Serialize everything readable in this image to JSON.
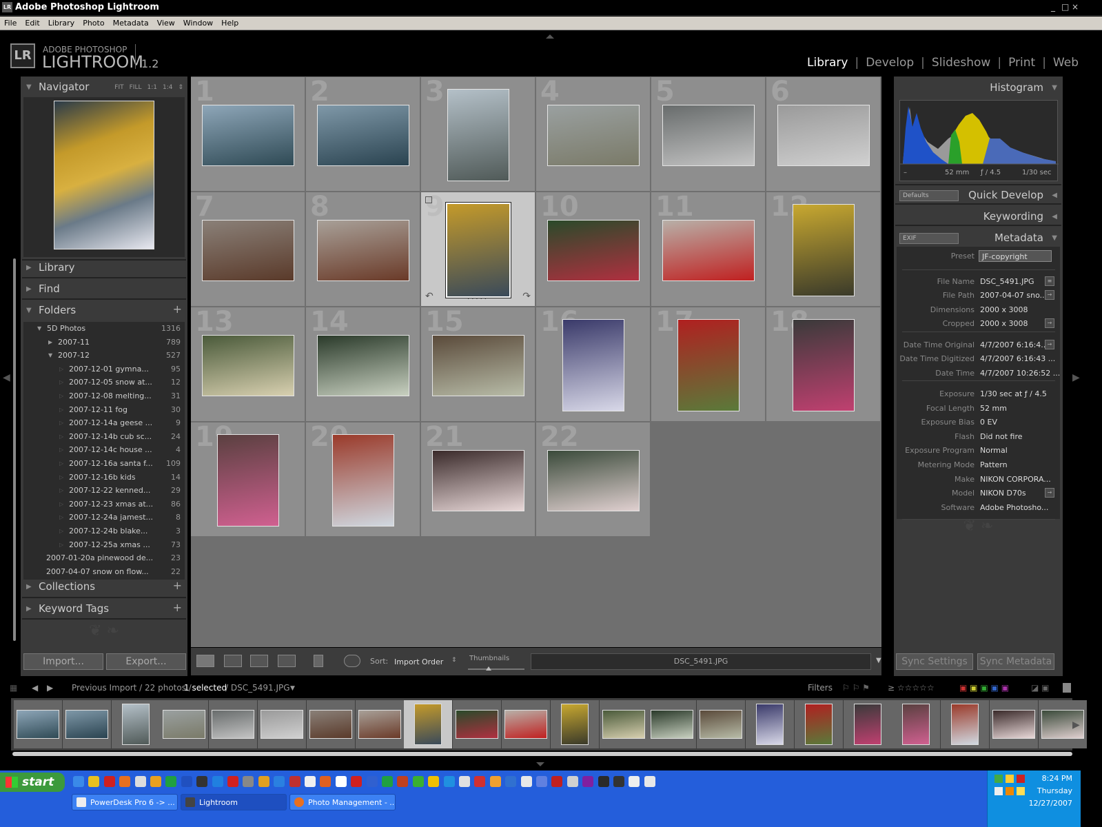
{
  "window": {
    "title": "Adobe Photoshop Lightroom",
    "controls": [
      "_",
      "□",
      "×"
    ]
  },
  "menu": [
    "File",
    "Edit",
    "Library",
    "Photo",
    "Metadata",
    "View",
    "Window",
    "Help"
  ],
  "logo": {
    "box": "LR",
    "line1": "ADOBE PHOTOSHOP",
    "line2": "LIGHTROOM",
    "version": "1.2"
  },
  "modules": [
    "Library",
    "Develop",
    "Slideshow",
    "Print",
    "Web"
  ],
  "navigator": {
    "label": "Navigator",
    "zoom": [
      "FIT",
      "FILL",
      "1:1",
      "1:4"
    ]
  },
  "left_panels": {
    "library": "Library",
    "find": "Find",
    "folders": "Folders",
    "collections": "Collections",
    "keyword_tags": "Keyword Tags"
  },
  "folders": [
    {
      "name": "5D Photos",
      "count": "1316",
      "level": 0,
      "expanded": true
    },
    {
      "name": "2007-11",
      "count": "789",
      "level": 1,
      "expanded": false
    },
    {
      "name": "2007-12",
      "count": "527",
      "level": 1,
      "expanded": true
    },
    {
      "name": "2007-12-01 gymna...",
      "count": "95",
      "level": 2
    },
    {
      "name": "2007-12-05 snow at...",
      "count": "12",
      "level": 2
    },
    {
      "name": "2007-12-08 melting...",
      "count": "31",
      "level": 2
    },
    {
      "name": "2007-12-11 fog",
      "count": "30",
      "level": 2
    },
    {
      "name": "2007-12-14a geese ...",
      "count": "9",
      "level": 2
    },
    {
      "name": "2007-12-14b cub sc...",
      "count": "24",
      "level": 2
    },
    {
      "name": "2007-12-14c house ...",
      "count": "4",
      "level": 2
    },
    {
      "name": "2007-12-16a santa f...",
      "count": "109",
      "level": 2
    },
    {
      "name": "2007-12-16b kids",
      "count": "14",
      "level": 2
    },
    {
      "name": "2007-12-22 kenned...",
      "count": "29",
      "level": 2
    },
    {
      "name": "2007-12-23 xmas at...",
      "count": "86",
      "level": 2
    },
    {
      "name": "2007-12-24a jamest...",
      "count": "8",
      "level": 2
    },
    {
      "name": "2007-12-24b blake...",
      "count": "3",
      "level": 2
    },
    {
      "name": "2007-12-25a xmas ...",
      "count": "73",
      "level": 2
    },
    {
      "name": "2007-01-20a pinewood de...",
      "count": "23",
      "level": -1
    },
    {
      "name": "2007-04-07 snow on flow...",
      "count": "22",
      "level": -1
    }
  ],
  "buttons": {
    "import": "Import...",
    "export": "Export...",
    "sync_settings": "Sync Settings",
    "sync_metadata": "Sync Metadata"
  },
  "grid": [
    {
      "n": "1",
      "o": "l",
      "c1": "#8ea6b8",
      "c2": "#2f4a55"
    },
    {
      "n": "2",
      "o": "l",
      "c1": "#7f98a8",
      "c2": "#2a4350"
    },
    {
      "n": "3",
      "o": "p",
      "c1": "#b4c0c8",
      "c2": "#505a58"
    },
    {
      "n": "4",
      "o": "l",
      "c1": "#9aa0a0",
      "c2": "#7a7a68"
    },
    {
      "n": "5",
      "o": "l",
      "c1": "#686c6c",
      "c2": "#c4c4c4"
    },
    {
      "n": "6",
      "o": "l",
      "c1": "#9a9a9a",
      "c2": "#d0d0d0"
    },
    {
      "n": "7",
      "o": "l",
      "c1": "#8a8078",
      "c2": "#5a3a2a"
    },
    {
      "n": "8",
      "o": "l",
      "c1": "#a8a098",
      "c2": "#6a3a28"
    },
    {
      "n": "9",
      "o": "p",
      "c1": "#c49a2a",
      "c2": "#3a4a5a",
      "selected": true
    },
    {
      "n": "10",
      "o": "l",
      "c1": "#2a4a2a",
      "c2": "#b03040"
    },
    {
      "n": "11",
      "o": "l",
      "c1": "#b8b0a8",
      "c2": "#c02020"
    },
    {
      "n": "12",
      "o": "p",
      "c1": "#c8a830",
      "c2": "#3a3a2a"
    },
    {
      "n": "13",
      "o": "l",
      "c1": "#4a5a3a",
      "c2": "#d8d0b0"
    },
    {
      "n": "14",
      "o": "l",
      "c1": "#2a3a2a",
      "c2": "#c8d0c0"
    },
    {
      "n": "15",
      "o": "l",
      "c1": "#5a4a3a",
      "c2": "#b8bca8"
    },
    {
      "n": "16",
      "o": "p",
      "c1": "#3a3a6a",
      "c2": "#d8d8e8"
    },
    {
      "n": "17",
      "o": "p",
      "c1": "#b02020",
      "c2": "#5a7a3a"
    },
    {
      "n": "18",
      "o": "p",
      "c1": "#3a3a3a",
      "c2": "#c04070"
    },
    {
      "n": "19",
      "o": "p",
      "c1": "#5a4040",
      "c2": "#d06090"
    },
    {
      "n": "20",
      "o": "p",
      "c1": "#9a3a2a",
      "c2": "#d0d8e0"
    },
    {
      "n": "21",
      "o": "l",
      "c1": "#3a2a2a",
      "c2": "#e8d8d8"
    },
    {
      "n": "22",
      "o": "l",
      "c1": "#3a4a3a",
      "c2": "#e0d0d0"
    }
  ],
  "toolbar": {
    "sort_label": "Sort:",
    "sort_value": "Import Order",
    "thumbnails_label": "Thumbnails",
    "filename": "DSC_5491.JPG"
  },
  "histogram": {
    "label": "Histogram",
    "focal": "52 mm",
    "aperture": "ƒ / 4.5",
    "shutter": "1/30 sec",
    "dash": "–"
  },
  "quick_develop": {
    "label": "Quick Develop",
    "preset": "Defaults"
  },
  "keywording": {
    "label": "Keywording"
  },
  "metadata": {
    "label": "Metadata",
    "set": "EXIF",
    "preset_label": "Preset",
    "preset_value": "JF-copyright",
    "rows": [
      {
        "k": "File Name",
        "v": "DSC_5491.JPG",
        "btn": "≡"
      },
      {
        "k": "File Path",
        "v": "2007-04-07 sno...",
        "btn": "→"
      },
      {
        "k": "Dimensions",
        "v": "2000 x 3008"
      },
      {
        "k": "Cropped",
        "v": "2000 x 3008",
        "btn": "→"
      },
      {
        "k": "Date Time Original",
        "v": "4/7/2007 6:16:4...",
        "btn": "→"
      },
      {
        "k": "Date Time Digitized",
        "v": "4/7/2007 6:16:43 ..."
      },
      {
        "k": "Date Time",
        "v": "4/7/2007 10:26:52 ..."
      },
      {
        "k": "Exposure",
        "v": "1/30 sec at ƒ / 4.5"
      },
      {
        "k": "Focal Length",
        "v": "52 mm"
      },
      {
        "k": "Exposure Bias",
        "v": "0 EV"
      },
      {
        "k": "Flash",
        "v": "Did not fire"
      },
      {
        "k": "Exposure Program",
        "v": "Normal"
      },
      {
        "k": "Metering Mode",
        "v": "Pattern"
      },
      {
        "k": "Make",
        "v": "NIKON CORPORA..."
      },
      {
        "k": "Model",
        "v": "NIKON D70s",
        "btn": "→"
      },
      {
        "k": "Software",
        "v": "Adobe Photosho..."
      }
    ]
  },
  "filmstrip_bar": {
    "source": "Previous Import / 22 photos /",
    "selected": "1 selected",
    "file": "/ DSC_5491.JPG",
    "filters": "Filters",
    "rating": "≥ ☆☆☆☆☆"
  },
  "taskbar": {
    "start": "start",
    "tasks": [
      "PowerDesk Pro 6 -> ...",
      "Lightroom",
      "Photo Management - ..."
    ],
    "time": "8:24 PM",
    "day": "Thursday",
    "date": "12/27/2007"
  }
}
